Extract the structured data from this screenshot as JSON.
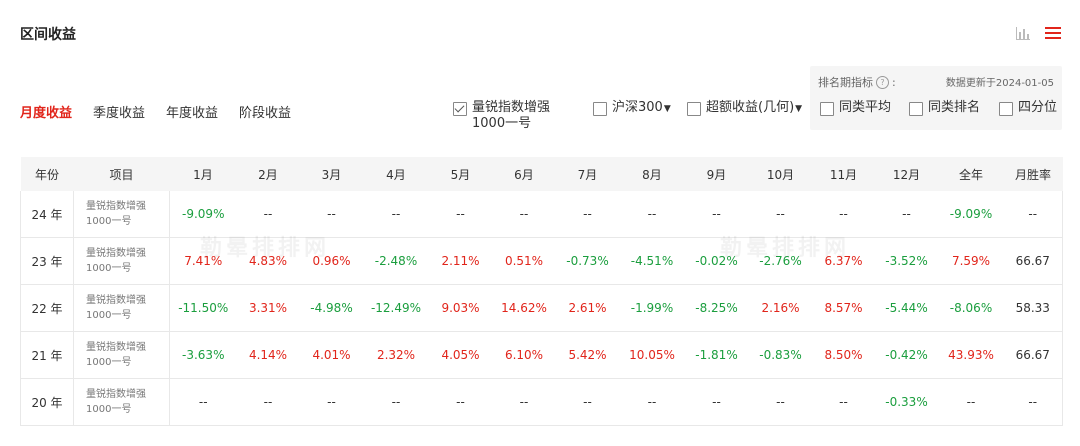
{
  "header": {
    "title": "区间收益"
  },
  "tabs": [
    {
      "label": "月度收益",
      "active": true
    },
    {
      "label": "季度收益",
      "active": false
    },
    {
      "label": "年度收益",
      "active": false
    },
    {
      "label": "阶段收益",
      "active": false
    }
  ],
  "checkboxes": {
    "fund": {
      "line1": "量锐指数增强",
      "line2": "1000一号",
      "checked": true
    },
    "hs300": {
      "label": "沪深300",
      "checked": false
    },
    "excess": {
      "label": "超额收益(几何)",
      "checked": false
    }
  },
  "metric": {
    "label": "排名期指标",
    "help_symbol": "?",
    "colon": ":",
    "updated": "数据更新于2024-01-05",
    "options": [
      {
        "label": "同类平均",
        "checked": false
      },
      {
        "label": "同类排名",
        "checked": false
      },
      {
        "label": "四分位",
        "checked": false
      }
    ]
  },
  "table": {
    "headers": [
      "年份",
      "项目",
      "1月",
      "2月",
      "3月",
      "4月",
      "5月",
      "6月",
      "7月",
      "8月",
      "9月",
      "10月",
      "11月",
      "12月",
      "全年",
      "月胜率"
    ],
    "item_line1": "量锐指数增强",
    "item_line2": "1000一号",
    "rows": [
      {
        "year": "24 年",
        "values": [
          "-9.09%",
          "--",
          "--",
          "--",
          "--",
          "--",
          "--",
          "--",
          "--",
          "--",
          "--",
          "--",
          "-9.09%",
          "--"
        ]
      },
      {
        "year": "23 年",
        "values": [
          "7.41%",
          "4.83%",
          "0.96%",
          "-2.48%",
          "2.11%",
          "0.51%",
          "-0.73%",
          "-4.51%",
          "-0.02%",
          "-2.76%",
          "6.37%",
          "-3.52%",
          "7.59%",
          "66.67"
        ]
      },
      {
        "year": "22 年",
        "values": [
          "-11.50%",
          "3.31%",
          "-4.98%",
          "-12.49%",
          "9.03%",
          "14.62%",
          "2.61%",
          "-1.99%",
          "-8.25%",
          "2.16%",
          "8.57%",
          "-5.44%",
          "-8.06%",
          "58.33"
        ]
      },
      {
        "year": "21 年",
        "values": [
          "-3.63%",
          "4.14%",
          "4.01%",
          "2.32%",
          "4.05%",
          "6.10%",
          "5.42%",
          "10.05%",
          "-1.81%",
          "-0.83%",
          "8.50%",
          "-0.42%",
          "43.93%",
          "66.67"
        ]
      },
      {
        "year": "20 年",
        "values": [
          "--",
          "--",
          "--",
          "--",
          "--",
          "--",
          "--",
          "--",
          "--",
          "--",
          "--",
          "-0.33%",
          "--",
          "--"
        ]
      }
    ]
  },
  "watermark": "勒晕排排网",
  "colors": {
    "accent": "#e1251b",
    "positive": "#e1251b",
    "negative": "#1b9e3e"
  },
  "icons": [
    "bar-chart-icon",
    "menu-icon",
    "help-icon"
  ]
}
